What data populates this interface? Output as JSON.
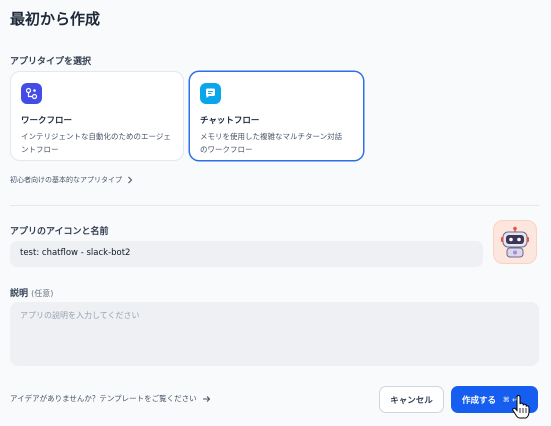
{
  "header": {
    "title": "最初から作成"
  },
  "app_type": {
    "label": "アプリタイプを選択",
    "cards": [
      {
        "name": "ワークフロー",
        "desc_line1": "インテリジェントな自動化のためのエージェ",
        "desc_line2": "ントフロー",
        "icon": "workflow-icon"
      },
      {
        "name": "チャットフロー",
        "desc_line1": "メモリを使用した複雑なマルチターン対話",
        "desc_line2": "のワークフロー",
        "icon": "chatflow-icon"
      }
    ],
    "guide_link": "初心者向けの基本的なアプリタイプ"
  },
  "app_info": {
    "label": "アプリのアイコンと名前",
    "name_value": "test: chatflow - slack-bot2",
    "avatar": "robot-avatar"
  },
  "description": {
    "label": "説明",
    "optional": "(任意)",
    "placeholder": "アプリの説明を入力してください"
  },
  "footer": {
    "template_link": "アイデアがありませんか？テンプレートをご覧ください",
    "cancel_label": "キャンセル",
    "create_label": "作成する",
    "create_shortcut": "⌘ ↵"
  },
  "colors": {
    "accent": "#155eef",
    "workflow_icon_bg": "#444ce7",
    "chatflow_icon_bg": "#0ba5ec"
  }
}
